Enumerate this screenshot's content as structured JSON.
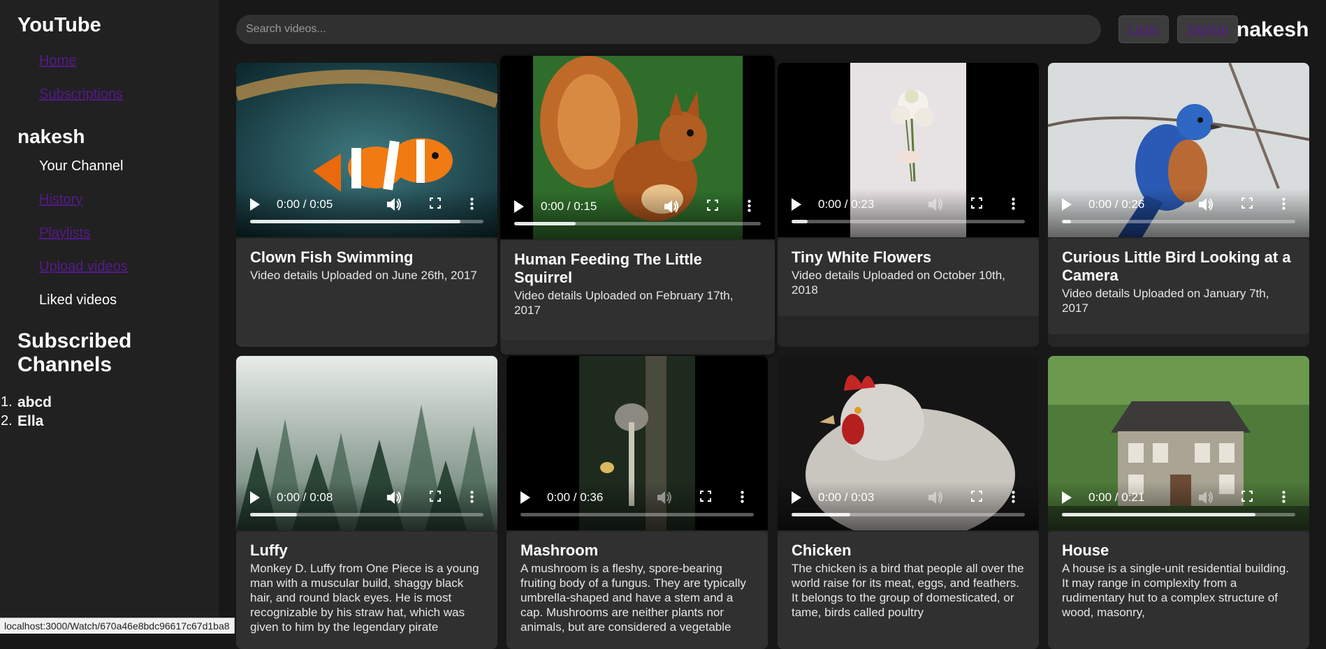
{
  "sidebar": {
    "brand": "YouTube",
    "nav": [
      {
        "label": "Home"
      },
      {
        "label": "Subscriptions"
      }
    ],
    "user_heading": "nakesh",
    "user_links": [
      {
        "label": "Your Channel",
        "style": "text"
      },
      {
        "label": "History",
        "style": "link"
      },
      {
        "label": "Playlists",
        "style": "link"
      },
      {
        "label": "Upload videos",
        "style": "link"
      },
      {
        "label": "Liked videos",
        "style": "text"
      }
    ],
    "subscribed_heading": "Subscribed Channels",
    "subscribed": [
      {
        "num": "1.",
        "name": "abcd"
      },
      {
        "num": "2.",
        "name": "Ella"
      }
    ]
  },
  "header": {
    "search_placeholder": "Search videos...",
    "login_label": "Login",
    "signup_label": "SignUp",
    "username": "nakesh"
  },
  "videos": [
    {
      "title": "Clown Fish Swimming",
      "details": "Video details Uploaded on June 26th, 2017",
      "time": "0:00 / 0:05",
      "progress": 0.9,
      "muted": false,
      "thumb": "clownfish"
    },
    {
      "title": "Human Feeding The Little Squirrel",
      "details": "Video details Uploaded on February 17th, 2017",
      "time": "0:00 / 0:15",
      "progress": 0.25,
      "muted": false,
      "thumb": "squirrel"
    },
    {
      "title": "Tiny White Flowers",
      "details": "Video details Uploaded on October 10th, 2018",
      "time": "0:00 / 0:23",
      "progress": 0.07,
      "muted": true,
      "thumb": "flowers"
    },
    {
      "title": "Curious Little Bird Looking at a Camera",
      "details": "Video details Uploaded on January 7th, 2017",
      "time": "0:00 / 0:26",
      "progress": 0.04,
      "muted": false,
      "thumb": "bird"
    },
    {
      "title": "Luffy",
      "details": "Monkey D. Luffy from One Piece is a young man with a muscular build, shaggy black hair, and round black eyes. He is most recognizable by his straw hat, which was given to him by the legendary pirate",
      "time": "0:00 / 0:08",
      "progress": 0.2,
      "muted": false,
      "thumb": "forest"
    },
    {
      "title": "Mashroom",
      "details": "A mushroom is a fleshy, spore-bearing fruiting body of a fungus. They are typically umbrella-shaped and have a stem and a cap. Mushrooms are neither plants nor animals, but are considered a vegetable",
      "time": "0:00 / 0:36",
      "progress": 0.0,
      "muted": true,
      "thumb": "mushroom"
    },
    {
      "title": "Chicken",
      "details": "The chicken is a bird that people all over the world raise for its meat, eggs, and feathers. It belongs to the group of domesticated, or tame, birds called poultry",
      "time": "0:00 / 0:03",
      "progress": 0.25,
      "muted": true,
      "thumb": "chicken"
    },
    {
      "title": "House",
      "details": "A house is a single-unit residential building. It may range in complexity from a rudimentary hut to a complex structure of wood, masonry,",
      "time": "0:00 / 0:21",
      "progress": 0.83,
      "muted": true,
      "thumb": "house"
    }
  ],
  "status_url": "localhost:3000/Watch/670a46e8bdc96617c67d1ba8"
}
